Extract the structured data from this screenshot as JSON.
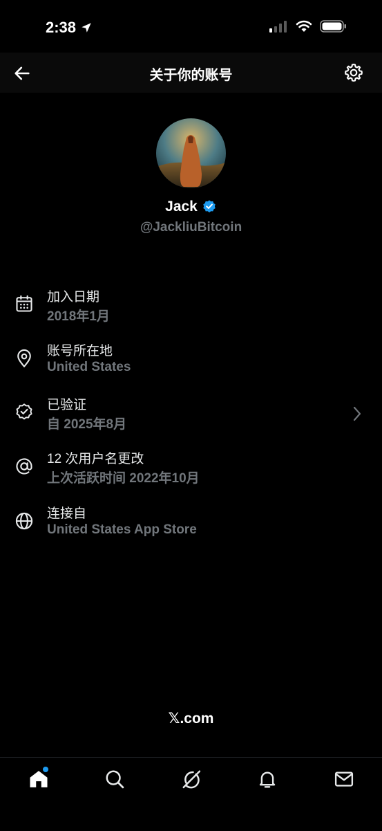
{
  "status_bar": {
    "time": "2:38"
  },
  "nav": {
    "title": "关于你的账号"
  },
  "profile": {
    "name": "Jack",
    "handle": "@JackliuBitcoin"
  },
  "info_items": [
    {
      "icon": "calendar-icon",
      "title": "加入日期",
      "subtitle": "2018年1月"
    },
    {
      "icon": "location-pin-icon",
      "title": "账号所在地",
      "subtitle": "United States"
    },
    {
      "icon": "verified-badge-icon",
      "title": "已验证",
      "subtitle": "自 2025年8月"
    },
    {
      "icon": "at-sign-icon",
      "title": "12 次用户名更改",
      "subtitle": "上次活跃时间 2022年10月"
    },
    {
      "icon": "globe-icon",
      "title": "连接自",
      "subtitle": "United States App Store"
    }
  ],
  "footer": {
    "text": "𝕏.com"
  },
  "tabs": [
    {
      "icon": "home-icon",
      "label": "Home",
      "has_dot": true
    },
    {
      "icon": "search-icon",
      "label": "Search"
    },
    {
      "icon": "grok-icon",
      "label": "Grok"
    },
    {
      "icon": "bell-icon",
      "label": "Notifications"
    },
    {
      "icon": "mail-icon",
      "label": "Messages"
    }
  ],
  "colors": {
    "accent": "#1d9bf0",
    "muted": "#71767b",
    "background": "#000000"
  }
}
